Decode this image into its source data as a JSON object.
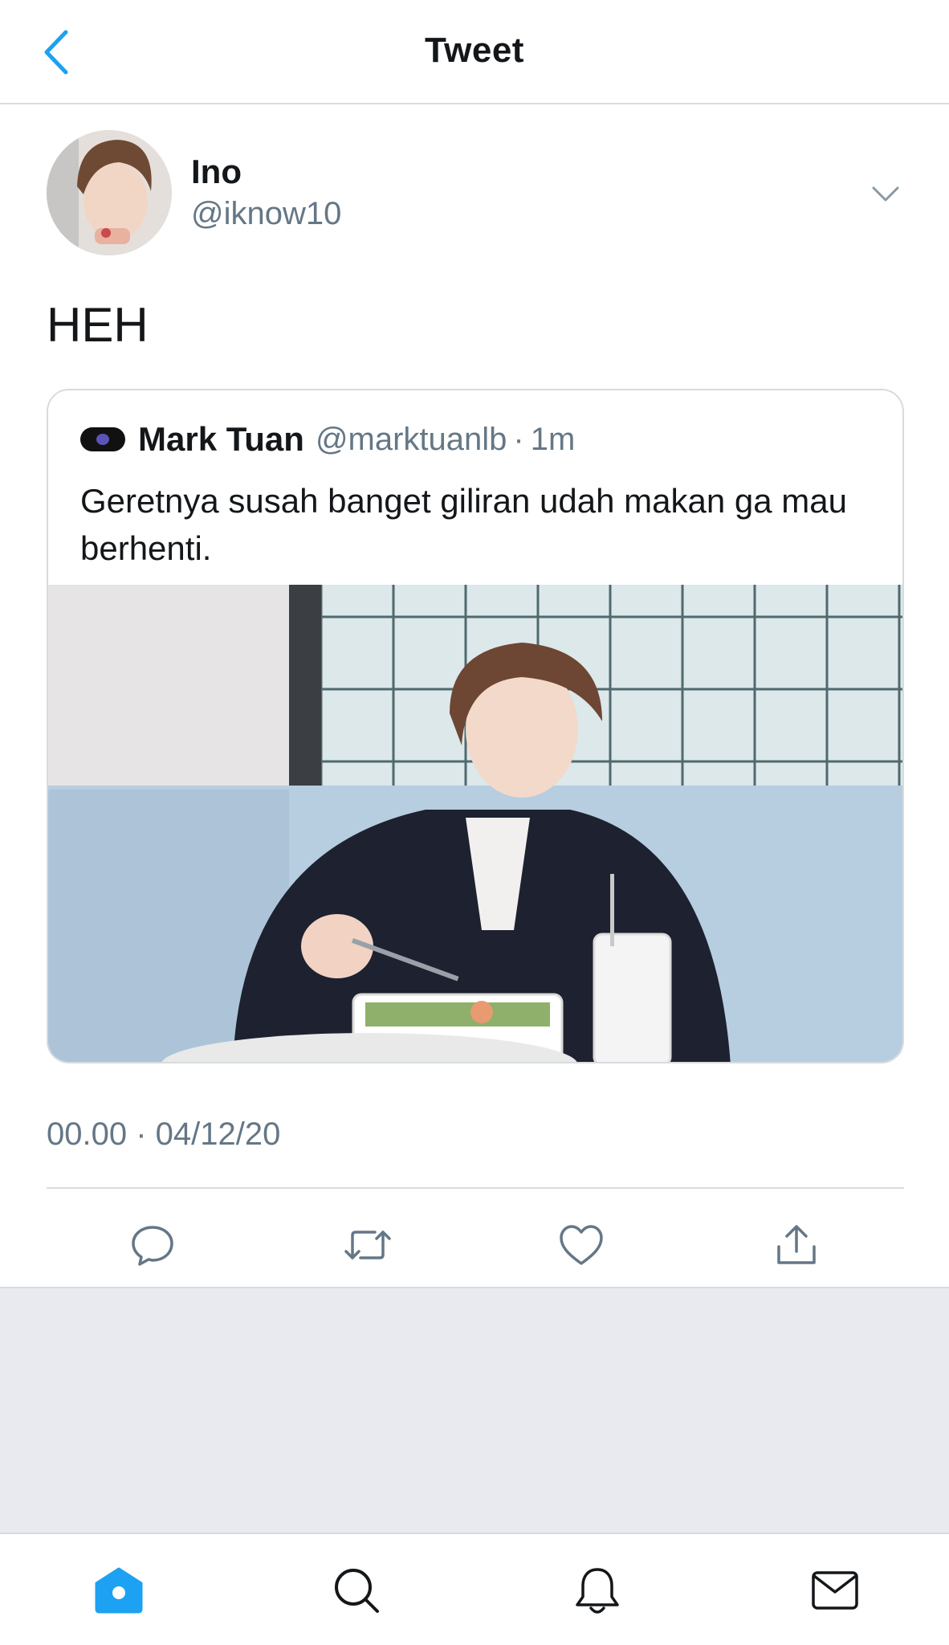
{
  "header": {
    "title": "Tweet"
  },
  "tweet": {
    "author_name": "Ino",
    "author_handle": "@iknow10",
    "text": "HEH",
    "timestamp": "00.00 · 04/12/20"
  },
  "quoted_tweet": {
    "author_name": "Mark Tuan",
    "author_handle": "@marktuanlb",
    "separator": "·",
    "time": "1m",
    "text": "Geretnya susah banget giliran udah makan ga mau berhenti."
  },
  "actions": [
    "reply-icon",
    "retweet-icon",
    "like-icon",
    "share-icon"
  ],
  "tabs": [
    "home-icon",
    "search-icon",
    "notifications-icon",
    "messages-icon"
  ],
  "colors": {
    "accent": "#1da1f2",
    "icon_gray": "#657786",
    "background_gray": "#e8eaef"
  }
}
